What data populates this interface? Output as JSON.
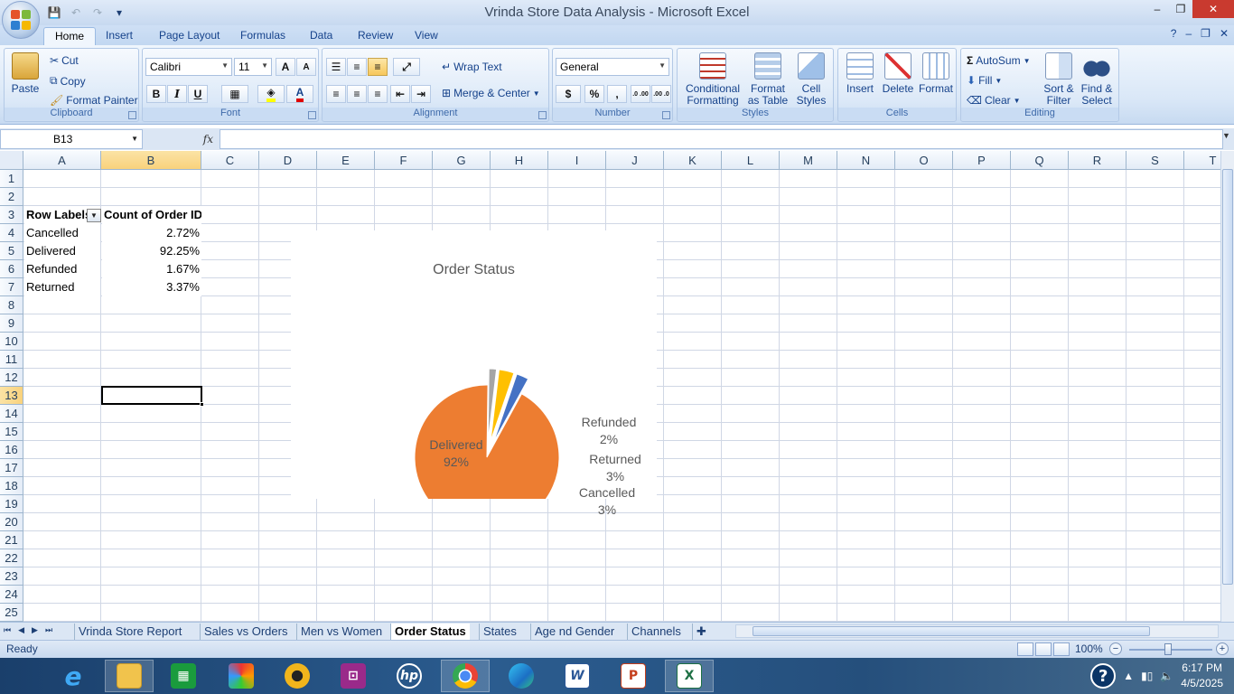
{
  "window": {
    "title": "Vrinda Store Data Analysis - Microsoft Excel",
    "minimize": "–",
    "restore": "❐",
    "close": "✕"
  },
  "ribbon_tabs": [
    "Home",
    "Insert",
    "Page Layout",
    "Formulas",
    "Data",
    "Review",
    "View"
  ],
  "clipboard": {
    "paste": "Paste",
    "cut": "Cut",
    "copy": "Copy",
    "format_painter": "Format Painter",
    "label": "Clipboard"
  },
  "font": {
    "name": "Calibri",
    "size": "11",
    "bold": "B",
    "italic": "I",
    "underline": "U",
    "label": "Font",
    "grow": "A",
    "shrink": "A"
  },
  "alignment": {
    "wrap_text": "Wrap Text",
    "merge_center": "Merge & Center",
    "label": "Alignment"
  },
  "number": {
    "format": "General",
    "currency": "$",
    "percent": "%",
    "comma": ",",
    "inc_decimal": ".0 .00",
    "dec_decimal": ".00 .0",
    "label": "Number"
  },
  "styles": {
    "conditional_1": "Conditional",
    "conditional_2": "Formatting",
    "format_table_1": "Format",
    "format_table_2": "as Table",
    "cell_styles_1": "Cell",
    "cell_styles_2": "Styles",
    "label": "Styles"
  },
  "cells": {
    "insert": "Insert",
    "delete": "Delete",
    "format": "Format",
    "label": "Cells"
  },
  "editing": {
    "autosum": "AutoSum",
    "fill": "Fill",
    "clear": "Clear",
    "sort_1": "Sort &",
    "sort_2": "Filter",
    "find_1": "Find &",
    "find_2": "Select",
    "label": "Editing"
  },
  "formula_bar": {
    "name_box": "B13",
    "fx": "fx",
    "value": ""
  },
  "columns": [
    "A",
    "B",
    "C",
    "D",
    "E",
    "F",
    "G",
    "H",
    "I",
    "J",
    "K",
    "L",
    "M",
    "N",
    "O",
    "P",
    "Q",
    "R",
    "S",
    "T"
  ],
  "rows": [
    "1",
    "2",
    "3",
    "4",
    "5",
    "6",
    "7",
    "8",
    "9",
    "10",
    "11",
    "12",
    "13",
    "14",
    "15",
    "16",
    "17",
    "18",
    "19",
    "20",
    "21",
    "22",
    "23",
    "24",
    "25"
  ],
  "pivot": {
    "header_row_labels": "Row Labels",
    "header_count": "Count of Order ID",
    "rows": [
      {
        "label": "Cancelled",
        "value": "2.72%"
      },
      {
        "label": "Delivered",
        "value": "92.25%"
      },
      {
        "label": "Refunded",
        "value": "1.67%"
      },
      {
        "label": "Returned",
        "value": "3.37%"
      }
    ]
  },
  "chart_data": {
    "type": "pie",
    "title": "Order Status",
    "categories": [
      "Cancelled",
      "Delivered",
      "Refunded",
      "Returned"
    ],
    "values": [
      2.72,
      92.25,
      1.67,
      3.37
    ],
    "colors": [
      "#4472c4",
      "#ed7d31",
      "#a5a5a5",
      "#ffc000"
    ],
    "data_labels": [
      {
        "name": "Cancelled",
        "pct": "3%"
      },
      {
        "name": "Delivered",
        "pct": "92%"
      },
      {
        "name": "Refunded",
        "pct": "2%"
      },
      {
        "name": "Returned",
        "pct": "3%"
      }
    ],
    "exploded": [
      "Cancelled",
      "Refunded",
      "Returned"
    ]
  },
  "sheets": [
    {
      "name": "Vrinda Store Report",
      "active": false
    },
    {
      "name": "Sales vs Orders",
      "active": false
    },
    {
      "name": "Men vs Women",
      "active": false
    },
    {
      "name": "Order Status",
      "active": true
    },
    {
      "name": "States",
      "active": false
    },
    {
      "name": "Age nd Gender",
      "active": false
    },
    {
      "name": "Channels",
      "active": false
    }
  ],
  "status": {
    "ready": "Ready",
    "zoom": "100%"
  },
  "taskbar": {
    "time": "6:17 PM",
    "date": "4/5/2025",
    "apps": [
      "windows-start",
      "internet-explorer",
      "file-explorer",
      "store",
      "game-app",
      "media-player",
      "presentation-app",
      "hp",
      "chrome",
      "edge",
      "word",
      "powerpoint",
      "excel"
    ]
  }
}
